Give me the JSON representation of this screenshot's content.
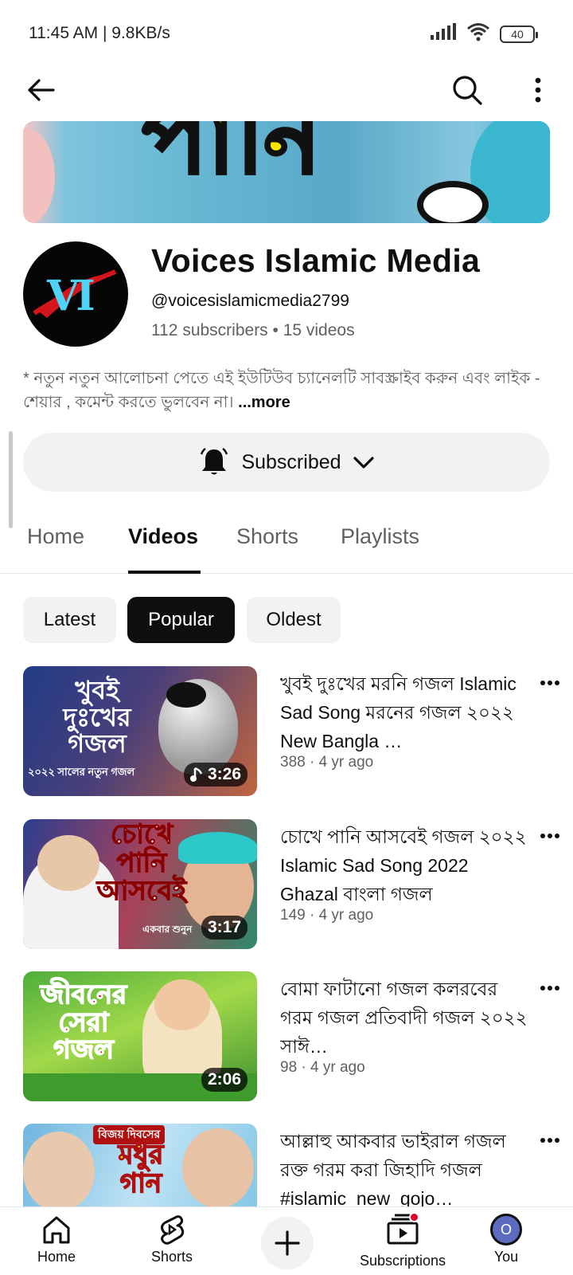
{
  "status_bar": {
    "time": "11:45 AM | 9.8KB/s",
    "battery": "40"
  },
  "banner": {
    "text": "পানি"
  },
  "channel": {
    "avatar_text": "VI",
    "name": "Voices Islamic Media",
    "handle": "@voicesislamicmedia2799",
    "stats": "112 subscribers • 15 videos",
    "description": "* নতুন নতুন আলোচনা পেতে এই ইউটিউব চ্যানেলটি সাবস্ক্রাইব করুন এবং লাইক - শেয়ার , কমেন্ট করতে ভুলবেন না। ",
    "description_more": "...more",
    "subscribe_label": "Subscribed"
  },
  "tabs": [
    {
      "label": "Home"
    },
    {
      "label": "Videos"
    },
    {
      "label": "Shorts"
    },
    {
      "label": "Playlists"
    }
  ],
  "chips": [
    {
      "label": "Latest"
    },
    {
      "label": "Popular"
    },
    {
      "label": "Oldest"
    }
  ],
  "videos": [
    {
      "title": "খুবই দুঃখের মরনি গজল Islamic Sad Song   মরনের গজল ২০২২   New Bangla …",
      "meta": "388 · 4 yr ago",
      "duration": "3:26",
      "thumb_caption": "খুবই দুঃখের গজল",
      "thumb_sub": "২০২২ সালের নতুন গজল"
    },
    {
      "title": "চোখে পানি আসবেই   গজল ২০২২   Islamic Sad Song 2022   Ghazal   বাংলা গজল",
      "meta": "149 · 4 yr ago",
      "duration": "3:17",
      "thumb_caption": "চোখে পানি আসবেই",
      "thumb_sub": "একবার শুনুন"
    },
    {
      "title": "বোমা ফাটানো গজল   কলরবের গরম গজল   প্রতিবাদী গজল ২০২২   সাঈ…",
      "meta": "98 · 4 yr ago",
      "duration": "2:06",
      "thumb_caption": "জীবনের সেরা গজল",
      "thumb_sub": ""
    },
    {
      "title": "আল্লাহু আকবার ভাইরাল গজল   রক্ত গরম করা জিহাদি গজল   #islamic_new_gojo…",
      "meta": "",
      "duration": "",
      "thumb_caption": "মধুর গান",
      "thumb_sub": "বিজয় দিবসের"
    }
  ],
  "bottom_nav": [
    {
      "label": "Home"
    },
    {
      "label": "Shorts"
    },
    {
      "label": "Subscriptions"
    },
    {
      "label": "You"
    }
  ],
  "you_avatar_letter": "O"
}
